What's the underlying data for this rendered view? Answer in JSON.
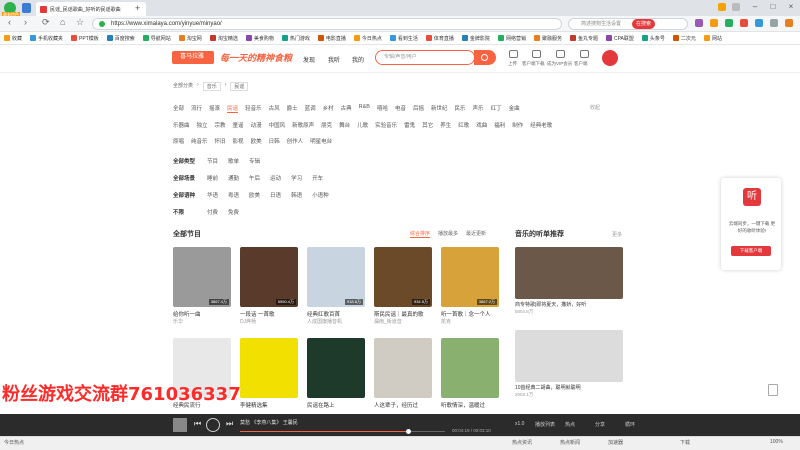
{
  "browser": {
    "tab_title": "民谣_民谣歌曲_好听的民谣歌曲",
    "badge": "最有特色",
    "url": "https://www.ximalaya.com/yinyue/minyao/",
    "search_placeholder": "简述搜狗生活设置",
    "search_btn": "在搜索"
  },
  "bookmarks": [
    "收藏",
    "手机收藏夹",
    "PPT模板",
    "百度搜索",
    "导航网站",
    "淘宝网",
    "淘宝精选",
    "美食购物",
    "热门游戏",
    "电影直播",
    "今日热点",
    "看到生活",
    "体育直播",
    "金牌影院",
    "网络营销",
    "聚融服务",
    "鱼丸专题",
    "CPA联盟",
    "头条号",
    "二次元",
    "网站"
  ],
  "header": {
    "logo": "喜马拉雅",
    "slogan": "每一天的精神食粮",
    "nav": [
      "发现",
      "我听",
      "我的"
    ],
    "search_placeholder": "专辑/声音/用户",
    "icons": [
      {
        "name": "upload-icon",
        "label": "上传"
      },
      {
        "name": "app-icon",
        "label": "客户端下载"
      },
      {
        "name": "vip-icon",
        "label": "成为VIP会员"
      },
      {
        "name": "phone-icon",
        "label": "下载APP"
      },
      {
        "name": "tv-icon",
        "label": "客户端"
      }
    ]
  },
  "breadcrumb": [
    "全部分类",
    "音乐",
    "民谣"
  ],
  "categories": {
    "row1": [
      "全部",
      "流行",
      "摇滚",
      "民谣",
      "轻音乐",
      "古风",
      "爵士",
      "蓝调",
      "乡村",
      "古典",
      "R&B",
      "嘻哈",
      "电音",
      "后摇",
      "新世纪",
      "民乐",
      "声乐",
      "红丁",
      "金曲"
    ],
    "more": "收起",
    "row2": [
      "乐器曲",
      "独立",
      "宗教",
      "童谣",
      "动漫",
      "中国风",
      "新歌原声",
      "朋克",
      "舞台",
      "儿歌",
      "实验音乐",
      "雷鬼",
      "其它",
      "养生",
      "红歌",
      "戏曲",
      "福利",
      "制作",
      "经典老歌"
    ],
    "row3": [
      "原唱",
      "纯音乐",
      "怀旧",
      "影视",
      "欧美",
      "日韩",
      "创作人",
      "明星电台"
    ]
  },
  "filters": [
    {
      "label": "全部类型",
      "options": [
        "节目",
        "歌单",
        "专辑"
      ]
    },
    {
      "label": "全部场景",
      "options": [
        "睡前",
        "通勤",
        "午后",
        "运动",
        "学习",
        "开车"
      ]
    },
    {
      "label": "全部语种",
      "options": [
        "华语",
        "粤语",
        "欧美",
        "日语",
        "韩语",
        "小语种"
      ]
    },
    {
      "label": "不限",
      "options": [
        "付费",
        "免费"
      ]
    }
  ],
  "programs": {
    "title": "全部节目",
    "sorts": [
      "综合排序",
      "播放最多",
      "最近更新"
    ],
    "cards": [
      {
        "title": "给你听一曲",
        "author": "乐华",
        "count": "3867.4万",
        "color": "#9a9a9a"
      },
      {
        "title": "一段话 一首歌",
        "author": "DJ烨杨",
        "count": "5950.4万",
        "color": "#5a3a2a"
      },
      {
        "title": "经典红歌百首",
        "author": "人成国旗播音机",
        "count": "918.6万",
        "color": "#c8d4e0"
      },
      {
        "title": "斯民民谣｜最真的歌",
        "author": "漏雨_街道音",
        "count": "934.5万",
        "color": "#6b4a2a"
      },
      {
        "title": "听一首歌｜念一个人",
        "author": "凯克",
        "count": "3867.2万",
        "color": "#d8a23a"
      },
      {
        "title": "经典民流行",
        "author": "",
        "count": "",
        "color": "#e8e8e8"
      },
      {
        "title": "李健精选集",
        "author": "",
        "count": "",
        "color": "#f2e000"
      },
      {
        "title": "民谣在路上",
        "author": "",
        "count": "",
        "color": "#1e3a2a"
      },
      {
        "title": "人这辈子，经历过",
        "author": "",
        "count": "",
        "color": "#d0ccc4"
      },
      {
        "title": "听歌情深，温暖过",
        "author": "",
        "count": "",
        "color": "#8ab070"
      }
    ]
  },
  "recommend": {
    "title": "音乐的听单推荐",
    "more": "更多",
    "items": [
      {
        "title": "商专特歌|即将夏天，撒娇，好听",
        "sub": "5004.8万",
        "color": "#6b5848"
      },
      {
        "title": "10首经典二胡曲，聪明就聪明",
        "sub": "2003.1万",
        "color": "#dcdcdc"
      }
    ]
  },
  "promo": {
    "icon": "听",
    "text": "云端同步，一键下载 更好的收听体验!",
    "button": "下载客户端"
  },
  "watermark": "粉丝游戏交流群761036337",
  "player": {
    "title": "莫愁 《李燕八集》 王馨民",
    "time": "00:04:19 / 00:03:10",
    "speed": "x1.0",
    "progress": 0.82,
    "right": [
      "播放列表",
      "热点",
      "画面",
      "分享",
      "循环",
      "下载"
    ]
  },
  "status": {
    "left": "今日热点",
    "items": [
      "热点资讯",
      "热点新闻",
      "加速器",
      "下载",
      "100%"
    ]
  }
}
